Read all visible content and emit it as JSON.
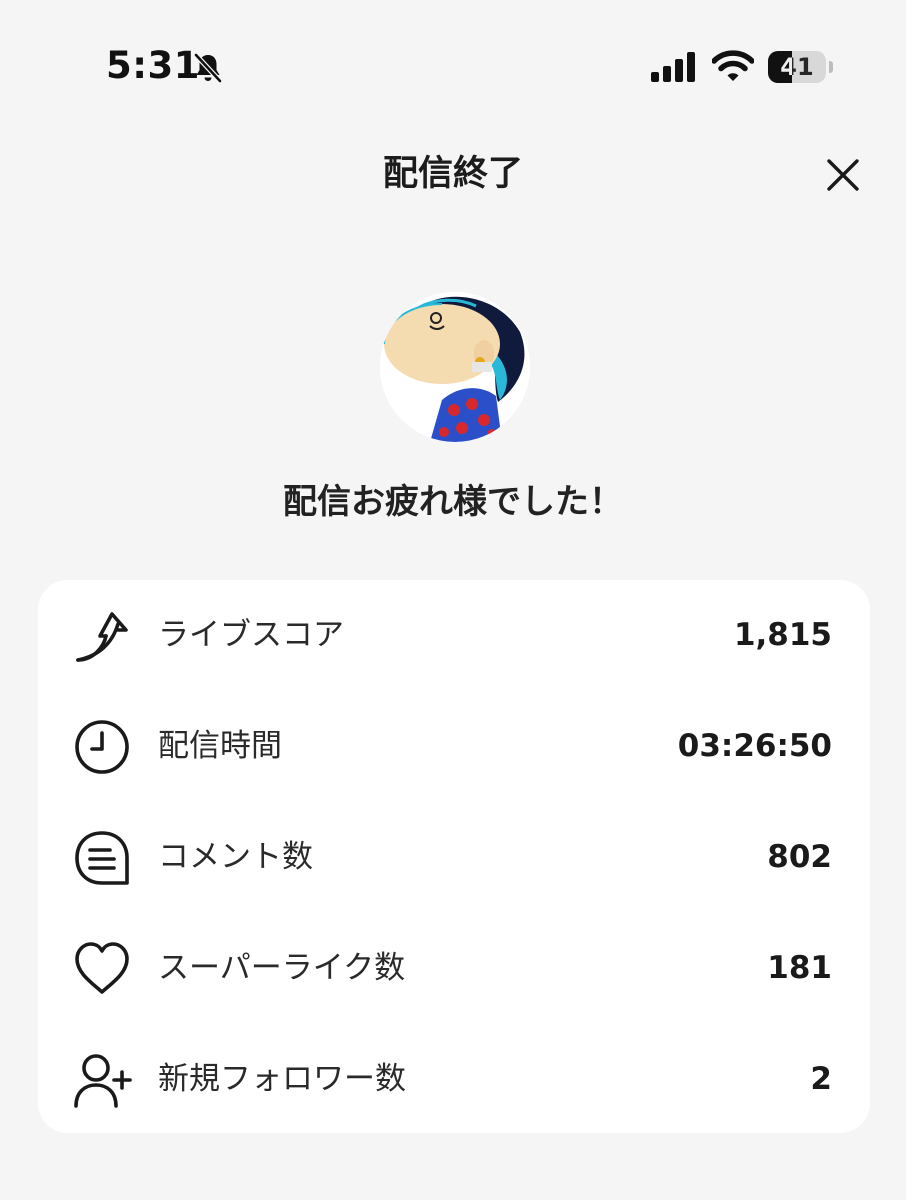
{
  "status_bar": {
    "time": "5:31",
    "battery_level": "41",
    "battery_fraction": 0.41,
    "icons": [
      "bell-slash-icon",
      "cellular-signal-icon",
      "wifi-icon",
      "battery-icon"
    ]
  },
  "header": {
    "title": "配信終了",
    "close_icon": "close-icon"
  },
  "main": {
    "message": "配信お疲れ様でした！"
  },
  "stats": [
    {
      "icon": "rising-arrow-icon",
      "label": "ライブスコア",
      "value": "1,815"
    },
    {
      "icon": "clock-icon",
      "label": "配信時間",
      "value": "03:26:50"
    },
    {
      "icon": "comment-icon",
      "label": "コメント数",
      "value": "802"
    },
    {
      "icon": "heart-icon",
      "label": "スーパーライク数",
      "value": "181"
    },
    {
      "icon": "person-add-icon",
      "label": "新規フォロワー数",
      "value": "2"
    }
  ],
  "colors": {
    "background": "#f5f5f5",
    "card": "#ffffff",
    "text": "#1e1e1e"
  }
}
